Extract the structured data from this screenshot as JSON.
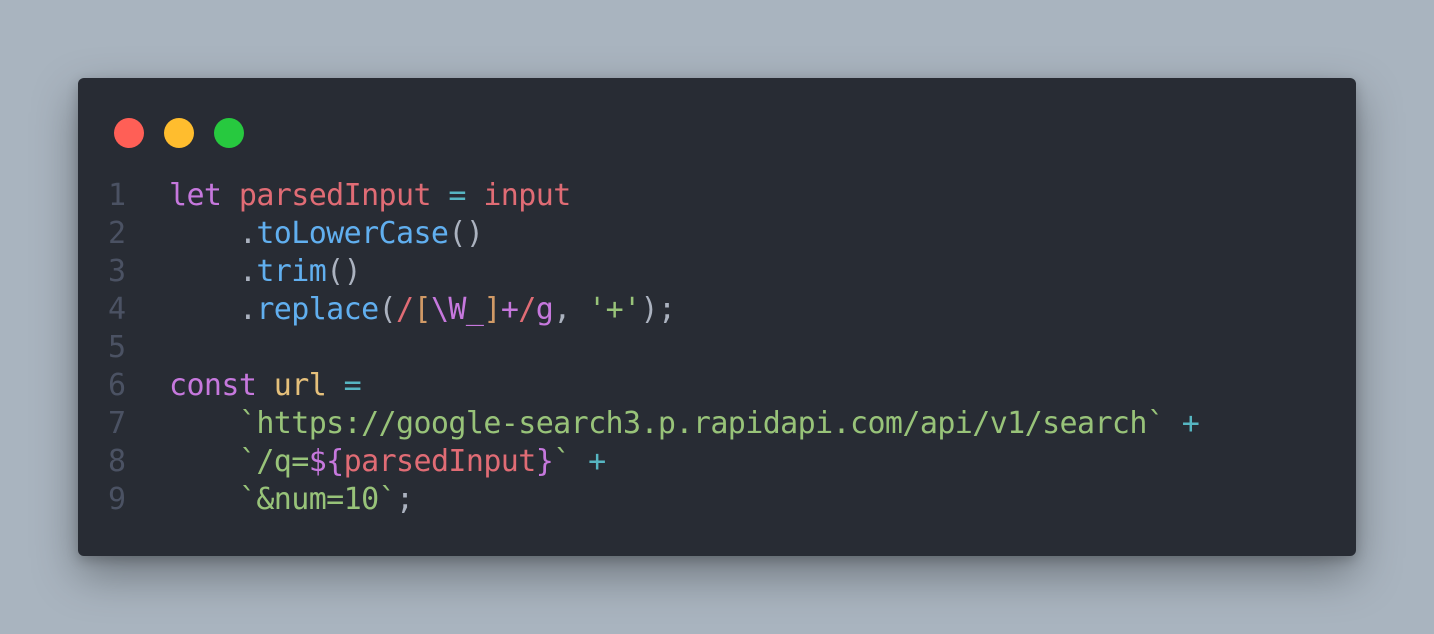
{
  "window": {
    "traffic_lights": [
      {
        "name": "close",
        "color": "#ff5f56"
      },
      {
        "name": "minimize",
        "color": "#ffbd2e"
      },
      {
        "name": "zoom",
        "color": "#27c93f"
      }
    ]
  },
  "theme": {
    "background": "#a9b4bf",
    "editor_background": "#282c34",
    "line_number": "#4b5263"
  },
  "code": {
    "language": "javascript",
    "lines": [
      {
        "number": "1",
        "tokens": [
          {
            "text": "let",
            "type": "keyword"
          },
          {
            "text": " ",
            "type": "punct"
          },
          {
            "text": "parsedInput",
            "type": "variable"
          },
          {
            "text": " ",
            "type": "punct"
          },
          {
            "text": "=",
            "type": "operator"
          },
          {
            "text": " ",
            "type": "punct"
          },
          {
            "text": "input",
            "type": "variable"
          }
        ]
      },
      {
        "number": "2",
        "tokens": [
          {
            "text": "    .",
            "type": "punct"
          },
          {
            "text": "toLowerCase",
            "type": "method"
          },
          {
            "text": "()",
            "type": "punct"
          }
        ]
      },
      {
        "number": "3",
        "tokens": [
          {
            "text": "    .",
            "type": "punct"
          },
          {
            "text": "trim",
            "type": "method"
          },
          {
            "text": "()",
            "type": "punct"
          }
        ]
      },
      {
        "number": "4",
        "tokens": [
          {
            "text": "    .",
            "type": "punct"
          },
          {
            "text": "replace",
            "type": "method"
          },
          {
            "text": "(",
            "type": "punct"
          },
          {
            "text": "/",
            "type": "regex-delim"
          },
          {
            "text": "[",
            "type": "regex-class"
          },
          {
            "text": "\\W_",
            "type": "regex-esc"
          },
          {
            "text": "]",
            "type": "regex-class"
          },
          {
            "text": "+",
            "type": "regex-esc"
          },
          {
            "text": "/",
            "type": "regex-delim"
          },
          {
            "text": "g",
            "type": "regex-flag"
          },
          {
            "text": ", ",
            "type": "punct"
          },
          {
            "text": "'+'",
            "type": "string"
          },
          {
            "text": ");",
            "type": "punct"
          }
        ]
      },
      {
        "number": "5",
        "tokens": []
      },
      {
        "number": "6",
        "tokens": [
          {
            "text": "const",
            "type": "keyword"
          },
          {
            "text": " ",
            "type": "punct"
          },
          {
            "text": "url",
            "type": "const-name"
          },
          {
            "text": " ",
            "type": "punct"
          },
          {
            "text": "=",
            "type": "operator"
          }
        ]
      },
      {
        "number": "7",
        "tokens": [
          {
            "text": "    ",
            "type": "punct"
          },
          {
            "text": "`https://google-search3.p.rapidapi.com/api/v1/search`",
            "type": "string"
          },
          {
            "text": " ",
            "type": "punct"
          },
          {
            "text": "+",
            "type": "operator"
          }
        ]
      },
      {
        "number": "8",
        "tokens": [
          {
            "text": "    ",
            "type": "punct"
          },
          {
            "text": "`/q=",
            "type": "string"
          },
          {
            "text": "${",
            "type": "interp"
          },
          {
            "text": "parsedInput",
            "type": "interp-var"
          },
          {
            "text": "}",
            "type": "interp"
          },
          {
            "text": "`",
            "type": "string"
          },
          {
            "text": " ",
            "type": "punct"
          },
          {
            "text": "+",
            "type": "operator"
          }
        ]
      },
      {
        "number": "9",
        "tokens": [
          {
            "text": "    ",
            "type": "punct"
          },
          {
            "text": "`&num=10`",
            "type": "string"
          },
          {
            "text": ";",
            "type": "punct"
          }
        ]
      }
    ]
  }
}
